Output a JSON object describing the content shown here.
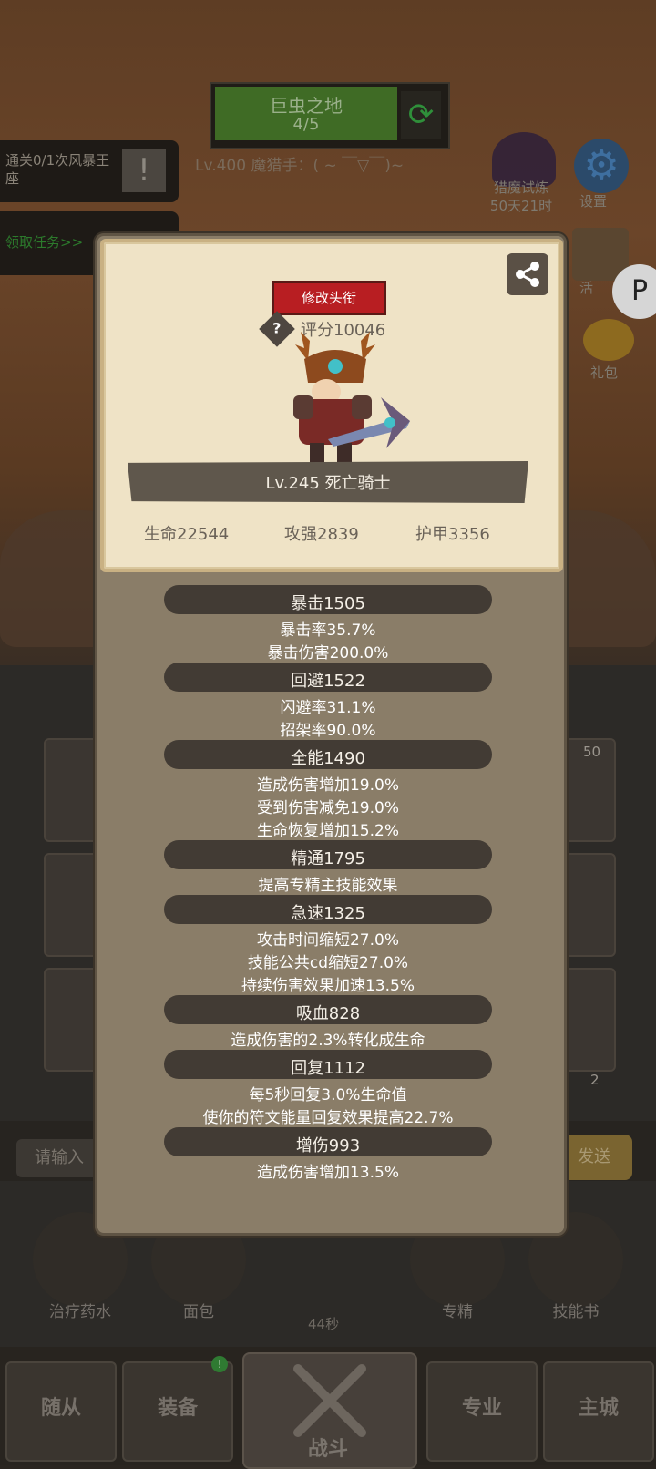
{
  "background": {
    "stage": {
      "name": "巨虫之地",
      "progress": "4/5"
    },
    "player_title": "Lv.400 魔猎手：( ~ ￣▽￣)~",
    "quest": {
      "text": "通关0/1次风暴王座",
      "claim_label": "领取任务>>"
    },
    "side_buttons": {
      "trial": "猎魔试炼",
      "trial_time": "50天21时",
      "settings": "设置",
      "events": "活",
      "gift": "礼包"
    },
    "chat": {
      "placeholder": "请输入",
      "send": "发送"
    },
    "slot_badges": {
      "top": "50",
      "bottom": "2"
    },
    "items": {
      "potion": "治疗药水",
      "bread": "面包",
      "timer": "44秒",
      "mastery": "专精",
      "skill_book": "技能书"
    },
    "nav": {
      "followers": "随从",
      "equipment": "装备",
      "battle": "战斗",
      "profession": "专业",
      "city": "主城",
      "badge": "!"
    }
  },
  "profile": {
    "edit_title_label": "修改头衔",
    "score_label": "评分10046",
    "hero_name": "Lv.245 死亡骑士",
    "core": {
      "hp": "生命22544",
      "power": "攻强2839",
      "armor": "护甲3356"
    },
    "help_glyph": "?"
  },
  "stats": [
    {
      "head": "暴击1505",
      "lines": [
        "暴击率35.7%",
        "暴击伤害200.0%"
      ]
    },
    {
      "head": "回避1522",
      "lines": [
        "闪避率31.1%",
        "招架率90.0%"
      ]
    },
    {
      "head": "全能1490",
      "lines": [
        "造成伤害增加19.0%",
        "受到伤害减免19.0%",
        "生命恢复增加15.2%"
      ]
    },
    {
      "head": "精通1795",
      "lines": [
        "提高专精主技能效果"
      ]
    },
    {
      "head": "急速1325",
      "lines": [
        "攻击时间缩短27.0%",
        "技能公共cd缩短27.0%",
        "持续伤害效果加速13.5%"
      ]
    },
    {
      "head": "吸血828",
      "lines": [
        "造成伤害的2.3%转化成生命"
      ]
    },
    {
      "head": "回复1112",
      "lines": [
        "每5秒回复3.0%生命值",
        "使你的符文能量回复效果提高22.7%"
      ]
    },
    {
      "head": "增伤993",
      "lines": [
        "造成伤害增加13.5%"
      ]
    }
  ],
  "colors": {
    "card": "#efe3c6",
    "modal": "#8a7d68",
    "bar": "#423b34",
    "edit_button": "#b81e22"
  }
}
